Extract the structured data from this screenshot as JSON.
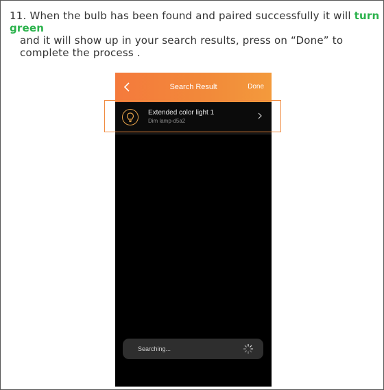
{
  "instruction": {
    "number": "11.",
    "text_before": "When the bulb has been found and paired successfully it will",
    "highlight": "turn green",
    "text_after": "and it will show up in your search results, press on “Done” to complete the process ."
  },
  "screen": {
    "title": "Search Result",
    "done_label": "Done",
    "device": {
      "name": "Extended color light 1",
      "subtitle": "Dim lamp-d5a2"
    },
    "status": "Searching...",
    "icons": [
      "back-arrow-icon",
      "bulb-icon",
      "chevron-right-icon",
      "spinner-icon"
    ]
  },
  "colors": {
    "highlight_text": "#2bb24c",
    "titlebar": "#f28a3a",
    "callout": "#f08a3e"
  }
}
